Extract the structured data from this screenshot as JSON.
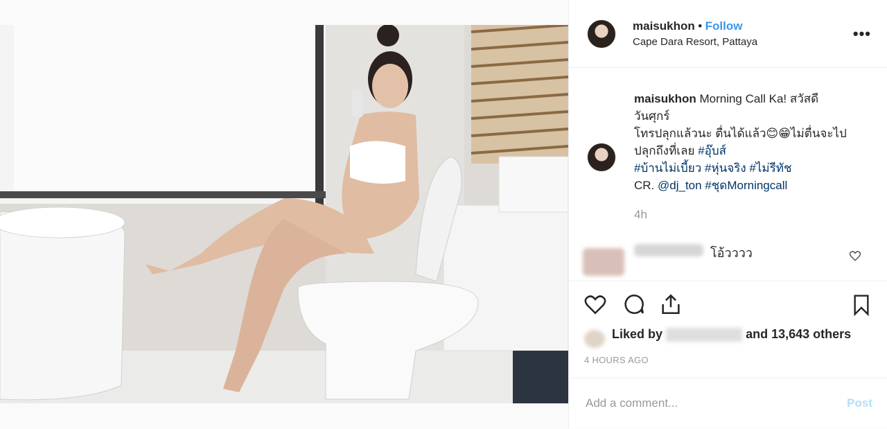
{
  "post": {
    "username": "maisukhon",
    "separator": "•",
    "follow_label": "Follow",
    "location": "Cape Dara Resort, Pattaya",
    "more_label": "•••"
  },
  "caption": {
    "username": "maisukhon",
    "line1": " Morning Call Ka! สวัสดี",
    "line2": "วันศุกร์",
    "line3": "โทรปลุกแล้วนะ ตื่นได้แล้ว😊😁ไม่ตื่นจะไป",
    "line4_text": "ปลุกถึงที่เลย ",
    "line4_tag": "#อุ๊บส์",
    "line5_tags": "#บ้านไม่เบี้ยว #หุ่นจริง #ไม่รีทัช",
    "line6_text": "CR. ",
    "line6_tags": "@dj_ton #ชุดMorningcall",
    "time": "4h"
  },
  "comment": {
    "text": "โอ้วววว"
  },
  "likes": {
    "prefix": "Liked by",
    "suffix": "and 13,643 others"
  },
  "timestamp": "4 HOURS AGO",
  "add_comment": {
    "placeholder": "Add a comment...",
    "post_label": "Post"
  },
  "colors": {
    "link_blue": "#3897f0",
    "hashtag": "#003569",
    "post_disabled": "#b2dffc"
  }
}
